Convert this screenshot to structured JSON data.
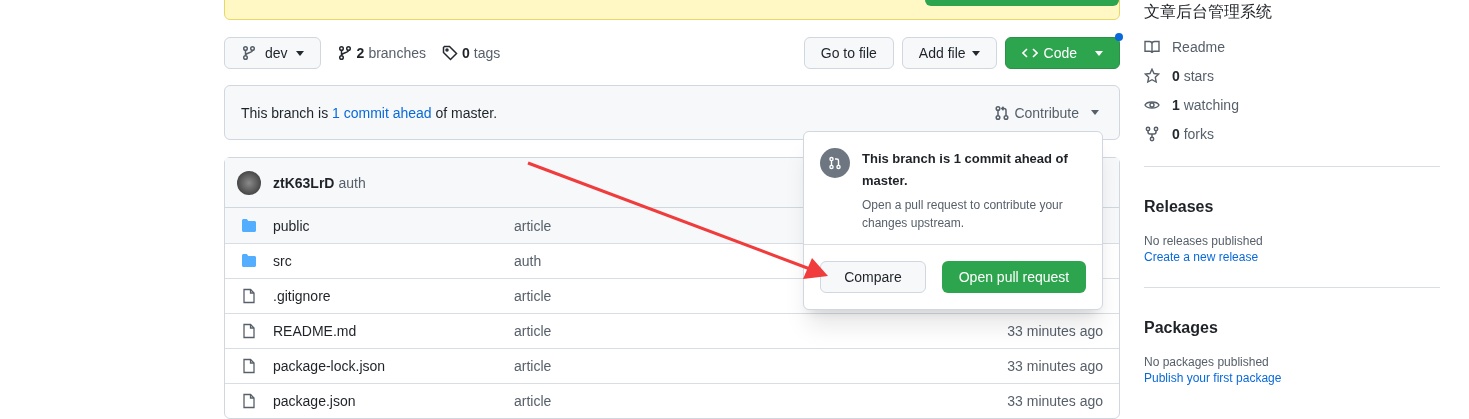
{
  "toolbar": {
    "branch": "dev",
    "branches_count": "2",
    "branches_label": "branches",
    "tags_count": "0",
    "tags_label": "tags",
    "buttons": [
      {
        "kind": "plain",
        "label": "Go to file",
        "caret": false
      },
      {
        "kind": "plain",
        "label": "Add file",
        "caret": true
      },
      {
        "kind": "code",
        "label": "Code",
        "caret": true,
        "notification": true
      }
    ]
  },
  "branch_bar": {
    "text_before": "This branch is ",
    "link": "1 commit ahead",
    "text_after": " of master.",
    "contribute": "Contribute"
  },
  "commit": {
    "author": "ztK63LrD",
    "message": "auth"
  },
  "files": [
    {
      "kind": "folder",
      "name": "public",
      "message": "article"
    },
    {
      "kind": "folder",
      "name": "src",
      "message": "auth"
    },
    {
      "kind": "file",
      "name": ".gitignore",
      "message": "article"
    },
    {
      "kind": "file",
      "name": "README.md",
      "message": "article",
      "time": "33 minutes ago"
    },
    {
      "kind": "file",
      "name": "package-lock.json",
      "message": "article",
      "time": "33 minutes ago"
    },
    {
      "kind": "file",
      "name": "package.json",
      "message": "article",
      "time": "33 minutes ago"
    }
  ],
  "popover": {
    "title": "This branch is 1 commit ahead of master.",
    "text": "Open a pull request to contribute your changes upstream.",
    "compare": "Compare",
    "open_pr": "Open pull request"
  },
  "sidebar": {
    "description": "文章后台管理系统",
    "stats": [
      {
        "kind": "book",
        "label": "Readme"
      },
      {
        "kind": "star",
        "count": "0",
        "label": "stars"
      },
      {
        "kind": "eye",
        "count": "1",
        "label": "watching"
      },
      {
        "kind": "fork",
        "count": "0",
        "label": "forks"
      }
    ],
    "sections": [
      {
        "title": "Releases",
        "text": "No releases published",
        "link": "Create a new release"
      },
      {
        "title": "Packages",
        "text": "No packages published",
        "link": "Publish your first package"
      }
    ]
  }
}
